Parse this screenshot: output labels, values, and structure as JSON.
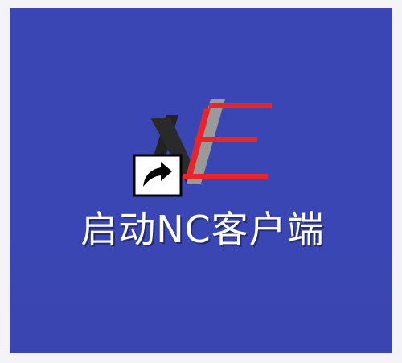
{
  "desktop": {
    "background": "#3a46b4",
    "shortcut": {
      "label": "启动NC客户端",
      "icon": "nc-logo-icon",
      "overlay_icon": "shortcut-arrow-icon",
      "colors": {
        "logo_dark": "#222222",
        "logo_gray": "#9a9a9a",
        "logo_red": "#e8242c"
      }
    }
  }
}
